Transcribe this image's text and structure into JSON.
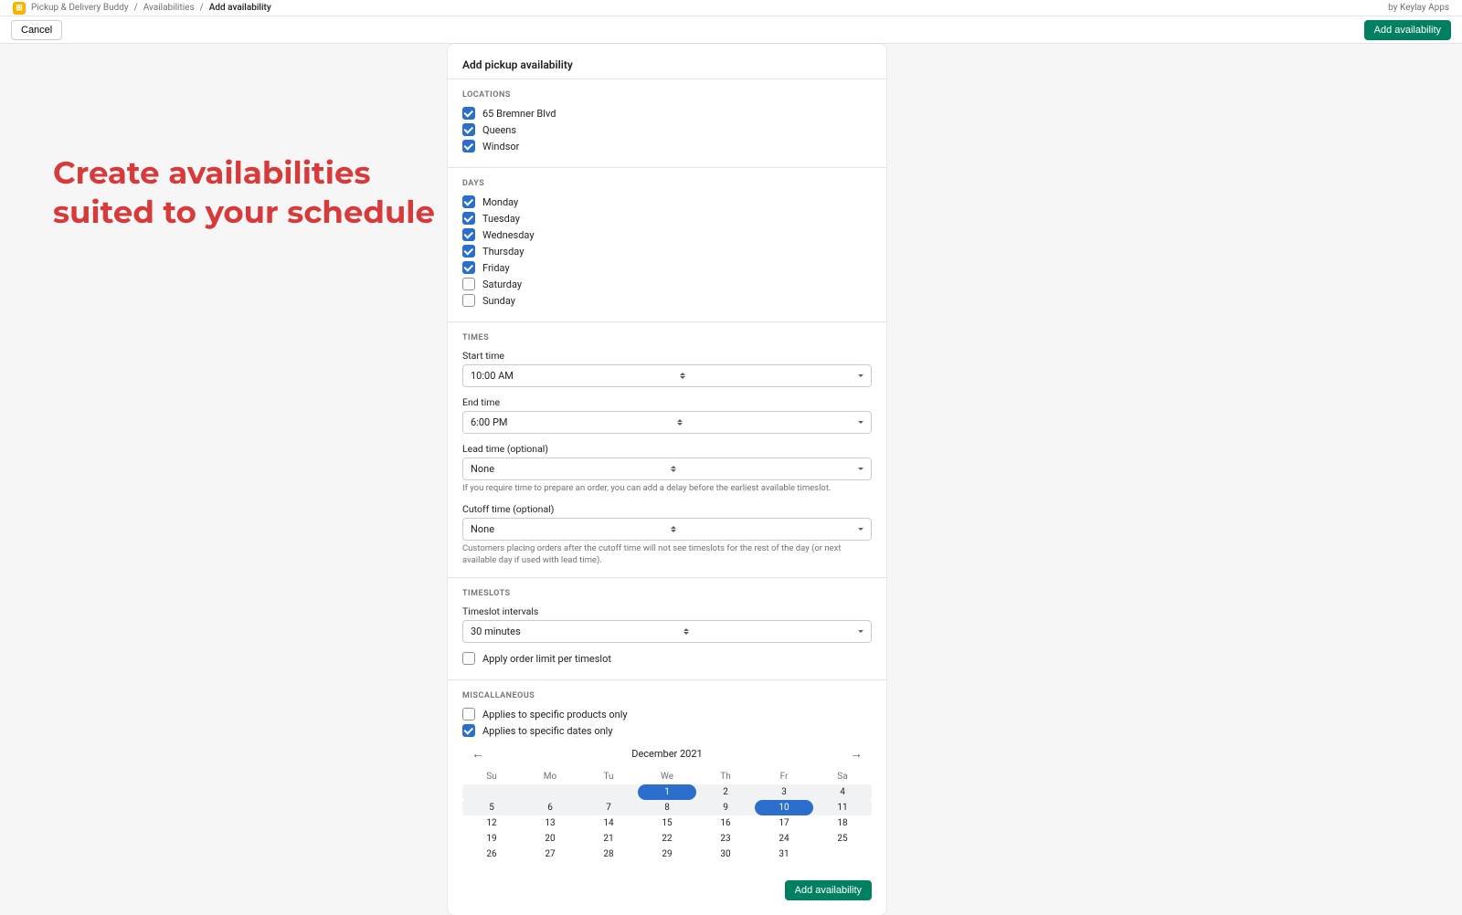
{
  "topbar": {
    "app_name": "Pickup & Delivery Buddy",
    "crumb2": "Availabilities",
    "crumb3": "Add availability",
    "vendor": "by Keylay Apps"
  },
  "actions": {
    "cancel": "Cancel",
    "add": "Add availability"
  },
  "hero": {
    "line1": "Create availabilities",
    "line2": "suited to your schedule"
  },
  "card": {
    "title": "Add pickup availability",
    "locations_label": "Locations",
    "locations": [
      {
        "label": "65 Bremner Blvd",
        "checked": true
      },
      {
        "label": "Queens",
        "checked": true
      },
      {
        "label": "Windsor",
        "checked": true
      }
    ],
    "days_label": "Days",
    "days": [
      {
        "label": "Monday",
        "checked": true
      },
      {
        "label": "Tuesday",
        "checked": true
      },
      {
        "label": "Wednesday",
        "checked": true
      },
      {
        "label": "Thursday",
        "checked": true
      },
      {
        "label": "Friday",
        "checked": true
      },
      {
        "label": "Saturday",
        "checked": false
      },
      {
        "label": "Sunday",
        "checked": false
      }
    ],
    "times_label": "Times",
    "start_label": "Start time",
    "start_value": "10:00 AM",
    "end_label": "End time",
    "end_value": "6:00 PM",
    "lead_label": "Lead time (optional)",
    "lead_value": "None",
    "lead_help": "If you require time to prepare an order, you can add a delay before the earliest available timeslot.",
    "cutoff_label": "Cutoff time (optional)",
    "cutoff_value": "None",
    "cutoff_help": "Customers placing orders after the cutoff time will not see timeslots for the rest of the day (or next available day if used with lead time).",
    "timeslots_label": "Timeslots",
    "interval_label": "Timeslot intervals",
    "interval_value": "30 minutes",
    "limit_label": "Apply order limit per timeslot",
    "misc_label": "Miscallaneous",
    "misc1": {
      "label": "Applies to specific products only",
      "checked": false
    },
    "misc2": {
      "label": "Applies to specific dates only",
      "checked": true
    },
    "cal_title": "December 2021",
    "dow": [
      "Su",
      "Mo",
      "Tu",
      "We",
      "Th",
      "Fr",
      "Sa"
    ],
    "weeks": [
      {
        "hl": true,
        "days": [
          {
            "n": "",
            "sel": false
          },
          {
            "n": "",
            "sel": false
          },
          {
            "n": "",
            "sel": false
          },
          {
            "n": "1",
            "sel": true
          },
          {
            "n": "2",
            "sel": false
          },
          {
            "n": "3",
            "sel": false
          },
          {
            "n": "4",
            "sel": false
          }
        ]
      },
      {
        "hl": true,
        "days": [
          {
            "n": "5"
          },
          {
            "n": "6"
          },
          {
            "n": "7"
          },
          {
            "n": "8"
          },
          {
            "n": "9"
          },
          {
            "n": "10",
            "sel": true
          },
          {
            "n": "11"
          }
        ]
      },
      {
        "hl": false,
        "days": [
          {
            "n": "12"
          },
          {
            "n": "13"
          },
          {
            "n": "14"
          },
          {
            "n": "15"
          },
          {
            "n": "16"
          },
          {
            "n": "17"
          },
          {
            "n": "18"
          }
        ]
      },
      {
        "hl": false,
        "days": [
          {
            "n": "19"
          },
          {
            "n": "20"
          },
          {
            "n": "21"
          },
          {
            "n": "22"
          },
          {
            "n": "23"
          },
          {
            "n": "24"
          },
          {
            "n": "25"
          }
        ]
      },
      {
        "hl": false,
        "days": [
          {
            "n": "26"
          },
          {
            "n": "27"
          },
          {
            "n": "28"
          },
          {
            "n": "29"
          },
          {
            "n": "30"
          },
          {
            "n": "31"
          },
          {
            "n": ""
          }
        ]
      }
    ],
    "footer_btn": "Add availability"
  }
}
